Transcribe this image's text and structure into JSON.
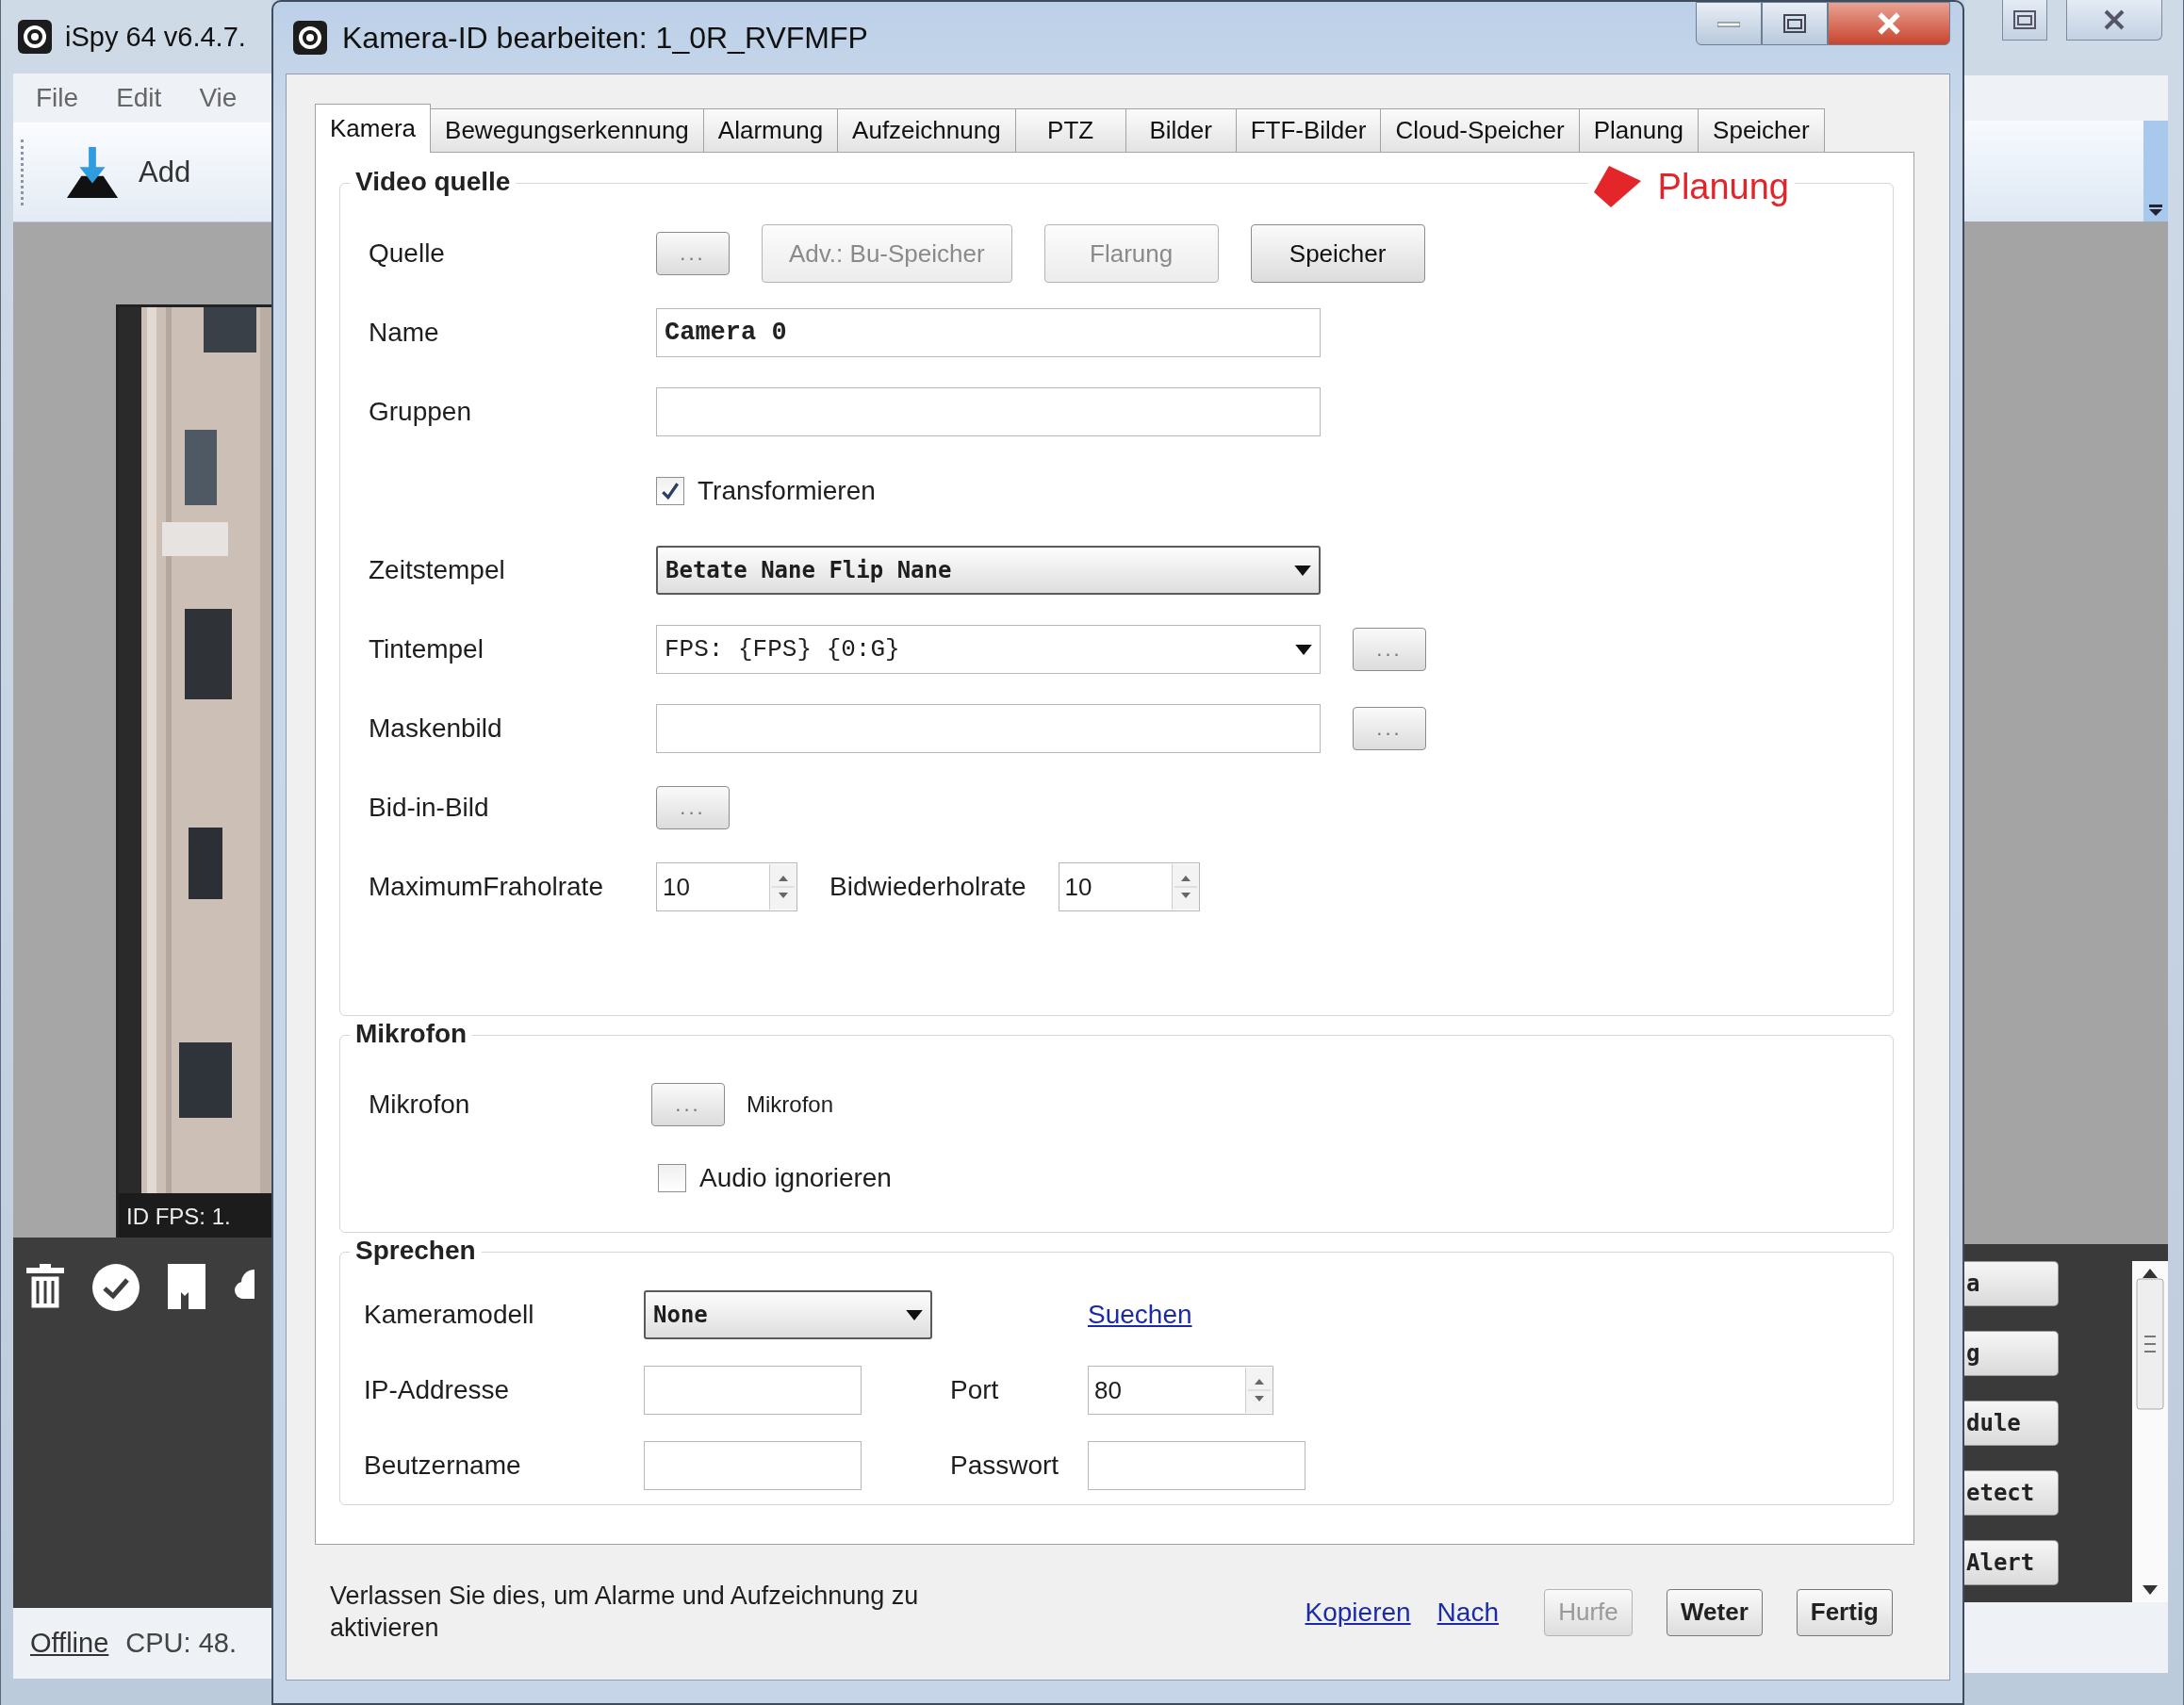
{
  "background_window": {
    "title": "iSpy 64 v6.4.7.",
    "menu": [
      "File",
      "Edit",
      "Vie"
    ],
    "add_label": "Add",
    "camera_overlay": "ID  FPS: 1.",
    "side_buttons": [
      "a",
      "g",
      "dule",
      "etect",
      "Alert"
    ],
    "status": {
      "link": "Offline",
      "text": "CPU: 48."
    }
  },
  "dialog": {
    "title": "Kamera-ID bearbeiten: 1_0R_RVFMFP",
    "tabs": [
      {
        "label": "Kamera",
        "selected": true
      },
      {
        "label": "Bewegungserkennung",
        "selected": false
      },
      {
        "label": "Alarmung",
        "selected": false
      },
      {
        "label": "Aufzeichnung",
        "selected": false
      },
      {
        "label": "PTZ",
        "selected": false
      },
      {
        "label": "Bilder",
        "selected": false
      },
      {
        "label": "FTF-Bilder",
        "selected": false
      },
      {
        "label": "Cloud-Speicher",
        "selected": false
      },
      {
        "label": "Planung",
        "selected": false
      },
      {
        "label": "Speicher",
        "selected": false
      }
    ],
    "annotation": "Planung",
    "groups": [
      {
        "title": "Video quelle",
        "kind": "form",
        "rows": [
          {
            "label": "Quelle",
            "controls": [
              {
                "kind": "browse",
                "label": "...",
                "disabled": false
              },
              {
                "kind": "button",
                "label": "Adv.: Bu-Speicher",
                "disabled": true
              },
              {
                "kind": "button",
                "label": "Flarung",
                "disabled": true
              },
              {
                "kind": "button",
                "label": "Speicher",
                "disabled": false
              }
            ]
          },
          {
            "label": "Name",
            "controls": [
              {
                "kind": "text",
                "value": "Camera 0"
              }
            ]
          },
          {
            "label": "Gruppen",
            "controls": [
              {
                "kind": "text"
              }
            ]
          },
          {
            "controls": [
              {
                "kind": "checkbox",
                "label": "Transformieren",
                "checked": true
              }
            ]
          },
          {
            "label": "Zeitstempel",
            "controls": [
              {
                "kind": "dropdown",
                "value": "Betate Nane Flip Nane"
              }
            ]
          },
          {
            "label": "Tintempel",
            "controls": [
              {
                "kind": "combo",
                "value": "FPS: {FPS} {0:G}"
              },
              {
                "kind": "browse",
                "label": "...",
                "disabled": false
              }
            ]
          },
          {
            "label": "Maskenbild",
            "controls": [
              {
                "kind": "text"
              },
              {
                "kind": "browse",
                "label": "...",
                "disabled": false
              }
            ]
          },
          {
            "label": "Bid-in-Bild",
            "controls": [
              {
                "kind": "browse",
                "label": "...",
                "disabled": false
              }
            ]
          },
          {
            "label": "MaximumFraholrate",
            "controls": [
              {
                "kind": "spinner",
                "value": "10"
              },
              {
                "kind": "label",
                "text": "Bidwiederholrate"
              },
              {
                "kind": "spinner",
                "value": "10"
              }
            ]
          }
        ]
      },
      {
        "title": "Mikrofon",
        "kind": "form",
        "rows": [
          {
            "label": "Mikrofon",
            "controls": [
              {
                "kind": "browse",
                "label": "...",
                "disabled": false
              },
              {
                "kind": "note",
                "text": "Mikrofon"
              }
            ]
          },
          {
            "controls": [
              {
                "kind": "checkbox",
                "label": "Audio ignorieren",
                "checked": false
              }
            ]
          }
        ]
      },
      {
        "title": "Sprechen",
        "kind": "grid",
        "rows": [
          {
            "label": "Kameramodell",
            "controls": [
              {
                "kind": "dropdown",
                "value": "None"
              },
              {
                "kind": "link",
                "text": "Suechen"
              }
            ]
          },
          {
            "label": "IP-Addresse",
            "controls": [
              {
                "kind": "text"
              },
              {
                "kind": "label",
                "text": "Port"
              },
              {
                "kind": "spinner",
                "value": "80"
              }
            ]
          },
          {
            "label": "Beutzername",
            "controls": [
              {
                "kind": "text"
              },
              {
                "kind": "label",
                "text": "Passwort"
              },
              {
                "kind": "text"
              }
            ]
          }
        ]
      }
    ],
    "footer": {
      "message": "Verlassen Sie dies, um Alarme und Aufzeichnung zu aktivieren",
      "links": [
        "Kopieren",
        "Nach"
      ],
      "buttons": [
        {
          "label": "Hurfe",
          "disabled": true
        },
        {
          "label": "Weter",
          "disabled": false
        },
        {
          "label": "Fertig",
          "disabled": false
        }
      ]
    }
  }
}
